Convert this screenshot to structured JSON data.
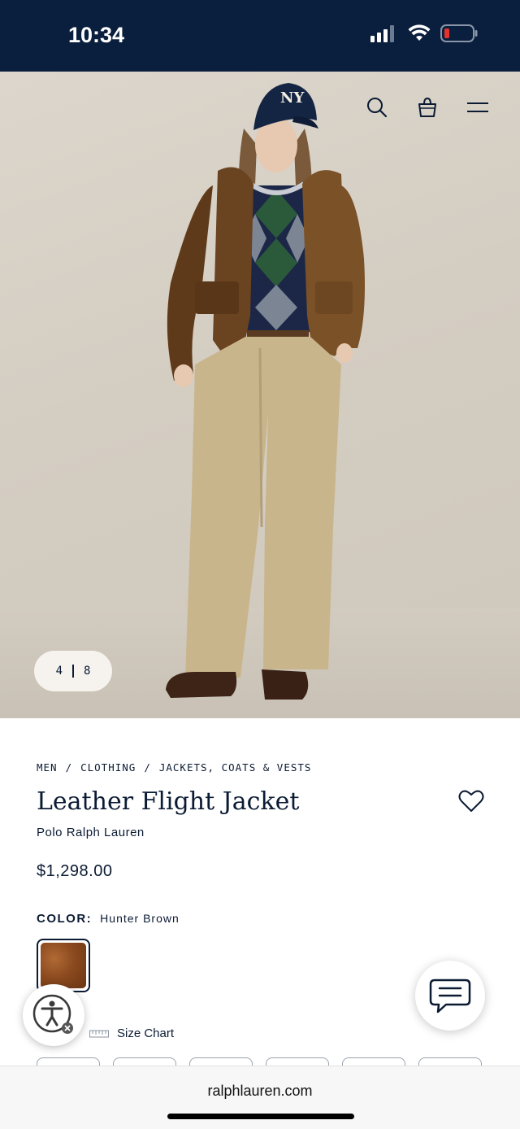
{
  "status_bar": {
    "time": "10:34",
    "signal_icon": "cellular-signal-icon",
    "wifi_icon": "wifi-icon",
    "battery_icon": "battery-low-icon",
    "battery_color": "#e5322d"
  },
  "header_icons": {
    "search": "search-icon",
    "bag": "shopping-bag-icon",
    "menu": "hamburger-menu-icon"
  },
  "gallery": {
    "current": "4",
    "total": "8"
  },
  "breadcrumb": {
    "items": [
      "MEN",
      "CLOTHING",
      "JACKETS, COATS & VESTS"
    ],
    "separator": "/"
  },
  "product": {
    "title": "Leather Flight Jacket",
    "brand": "Polo Ralph Lauren",
    "price": "$1,298.00",
    "color_label": "COLOR:",
    "color_value": "Hunter Brown",
    "swatch_color": "#8c4a1f",
    "favorite_icon": "heart-icon"
  },
  "size": {
    "size_chart_label": "Size Chart",
    "size_chart_icon": "ruler-icon"
  },
  "floating": {
    "accessibility_icon": "accessibility-icon",
    "chat_icon": "chat-bubble-icon"
  },
  "browser": {
    "url": "ralphlauren.com"
  },
  "colors": {
    "navy": "#0a1f3d",
    "text": "#0b1b33"
  }
}
